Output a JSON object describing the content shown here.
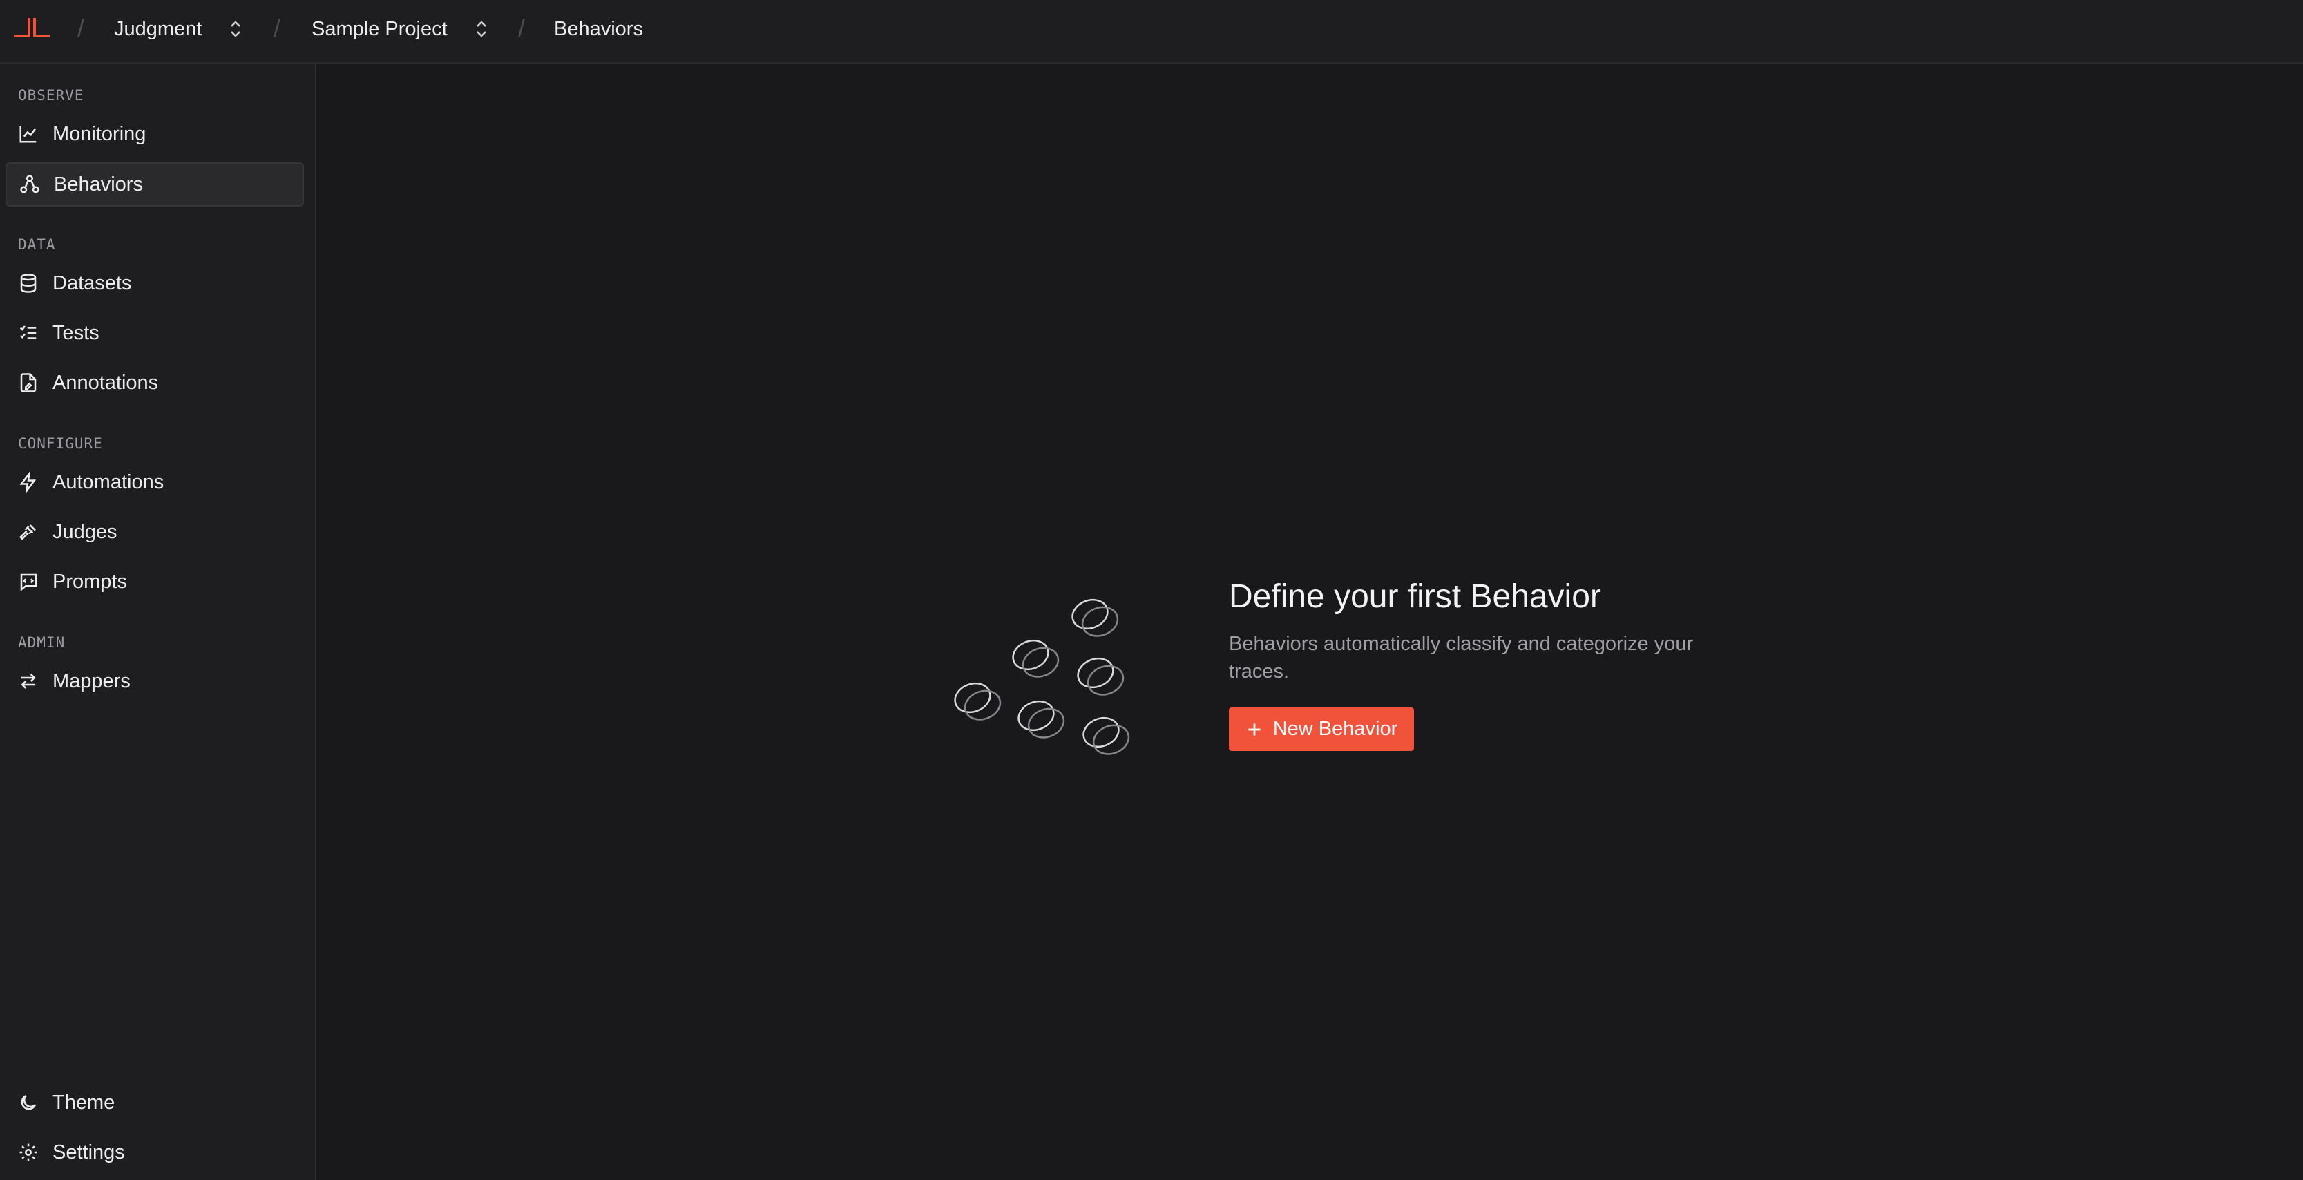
{
  "breadcrumb": {
    "org": "Judgment",
    "project": "Sample Project",
    "page": "Behaviors"
  },
  "sidebar": {
    "sections": [
      {
        "label": "OBSERVE",
        "items": [
          {
            "label": "Monitoring",
            "icon": "chart-line-icon"
          },
          {
            "label": "Behaviors",
            "icon": "nodes-icon",
            "active": true
          }
        ]
      },
      {
        "label": "DATA",
        "items": [
          {
            "label": "Datasets",
            "icon": "database-icon"
          },
          {
            "label": "Tests",
            "icon": "checklist-icon"
          },
          {
            "label": "Annotations",
            "icon": "annotation-file-icon"
          }
        ]
      },
      {
        "label": "CONFIGURE",
        "items": [
          {
            "label": "Automations",
            "icon": "lightning-icon"
          },
          {
            "label": "Judges",
            "icon": "gavel-icon"
          },
          {
            "label": "Prompts",
            "icon": "prompt-icon"
          }
        ]
      },
      {
        "label": "ADMIN",
        "items": [
          {
            "label": "Mappers",
            "icon": "arrows-swap-icon"
          }
        ]
      }
    ],
    "footer": [
      {
        "label": "Theme",
        "icon": "moon-icon"
      },
      {
        "label": "Settings",
        "icon": "gear-icon"
      }
    ]
  },
  "empty_state": {
    "title": "Define your first Behavior",
    "description": "Behaviors automatically classify and categorize your traces.",
    "button_label": "New Behavior"
  },
  "colors": {
    "accent": "#f0533a",
    "background": "#19191b",
    "sidebar": "#1e1e20"
  }
}
